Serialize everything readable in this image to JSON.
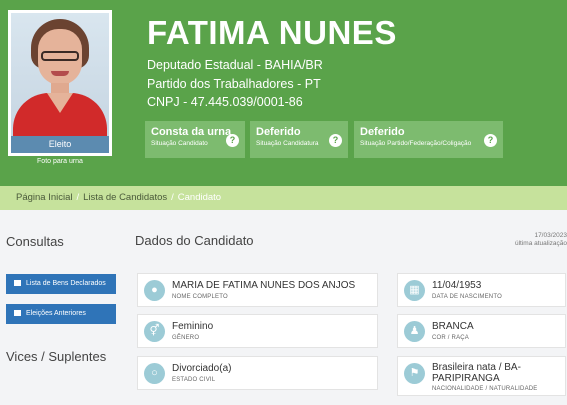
{
  "candidate": {
    "name": "FATIMA NUNES",
    "office": "Deputado Estadual - BAHIA/BR",
    "party": "Partido dos Trabalhadores - PT",
    "cnpj": "CNPJ - 47.445.039/0001-86",
    "result_badge": "Eleito",
    "photo_caption": "Foto para urna"
  },
  "statuses": [
    {
      "title": "Consta da urna",
      "subtitle": "Situação Candidato",
      "help_icon": "question-circle-icon"
    },
    {
      "title": "Deferido",
      "subtitle": "Situação Candidatura",
      "help_icon": "question-circle-icon"
    },
    {
      "title": "Deferido",
      "subtitle": "Situação Partido/Federação/Coligação",
      "help_icon": "question-circle-icon"
    }
  ],
  "breadcrumb": [
    "Página Inicial",
    "Lista de Candidatos",
    "Candidato"
  ],
  "sidebar": {
    "consultas_heading": "Consultas",
    "buttons": [
      {
        "label": "Lista de Bens Declarados",
        "icon": "list-icon"
      },
      {
        "label": "Eleições Anteriores",
        "icon": "list-icon"
      }
    ],
    "vices_heading": "Vices / Suplentes"
  },
  "main": {
    "heading": "Dados do Candidato",
    "updated_date": "17/03/2023",
    "updated_label": "última atualização"
  },
  "fields": [
    {
      "value": "MARIA DE FATIMA NUNES DOS ANJOS",
      "label": "NOME COMPLETO",
      "icon": "user-icon"
    },
    {
      "value": "Feminino",
      "label": "GÊNERO",
      "icon": "gender-icon"
    },
    {
      "value": "Divorciado(a)",
      "label": "ESTADO CIVIL",
      "icon": "ring-icon"
    },
    {
      "value": "11/04/1953",
      "label": "DATA DE NASCIMENTO",
      "icon": "calendar-icon"
    },
    {
      "value": "BRANCA",
      "label": "COR / RAÇA",
      "icon": "person-icon"
    },
    {
      "value": "Brasileira nata / BA-PARIPIRANGA",
      "label": "NACIONALIDADE / NATURALIDADE",
      "icon": "map-icon"
    }
  ],
  "colors": {
    "header_green": "#5aa34a",
    "status_green": "#7dbb6f",
    "breadcrumb": "#c6e29c",
    "button_blue": "#2f74b8",
    "icon_circle": "#9ccbd6"
  }
}
